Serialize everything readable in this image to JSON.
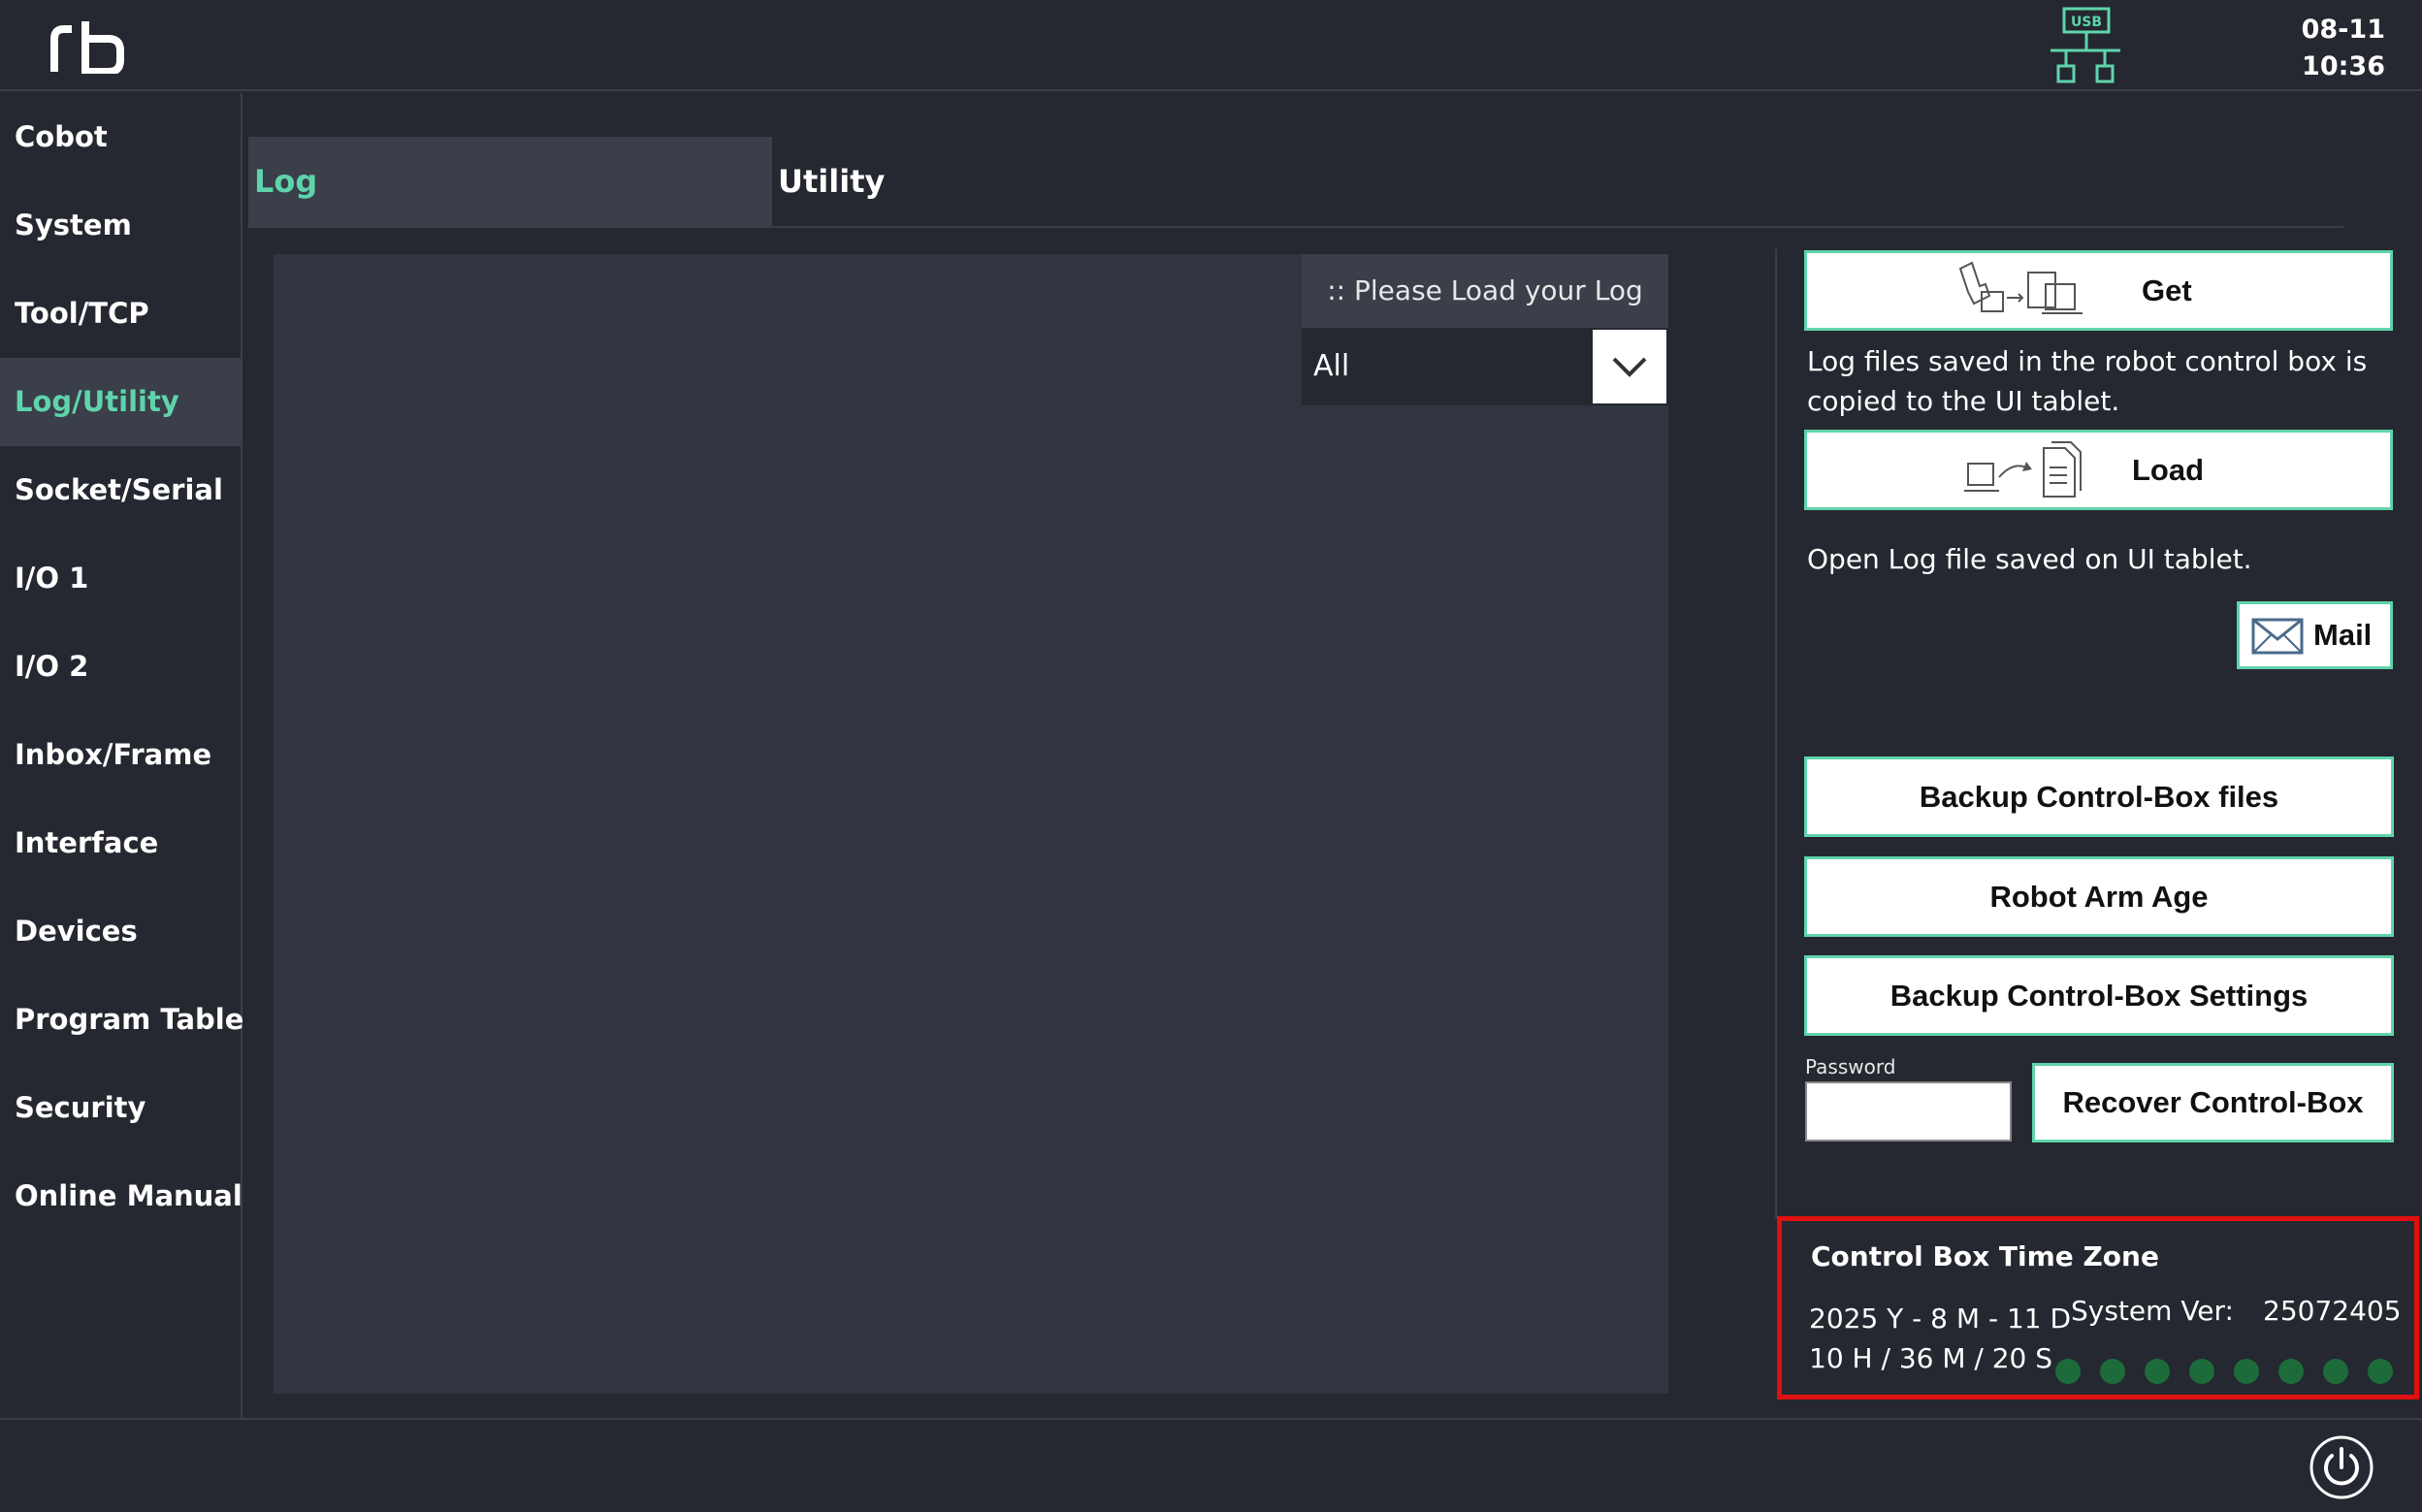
{
  "header": {
    "date": "08-11",
    "time": "10:36",
    "usb_label": "USB"
  },
  "sidebar": {
    "items": [
      {
        "label": "Cobot"
      },
      {
        "label": "System"
      },
      {
        "label": "Tool/TCP"
      },
      {
        "label": "Log/Utility",
        "active": true
      },
      {
        "label": "Socket/Serial"
      },
      {
        "label": "I/O 1"
      },
      {
        "label": "I/O 2"
      },
      {
        "label": "Inbox/Frame"
      },
      {
        "label": "Interface"
      },
      {
        "label": "Devices"
      },
      {
        "label": "Program Table"
      },
      {
        "label": "Security"
      },
      {
        "label": "Online Manual"
      }
    ]
  },
  "tabs": [
    {
      "label": "Log",
      "active": true
    },
    {
      "label": "Utility"
    }
  ],
  "log_panel": {
    "hint": ":: Please Load your Log",
    "filter_value": "All"
  },
  "utility": {
    "get_label": "Get",
    "get_desc_line1": "Log files saved in the robot control box is",
    "get_desc_line2": "copied to the UI tablet.",
    "load_label": "Load",
    "load_desc": "Open Log file saved on UI tablet.",
    "mail_label": "Mail",
    "backup_files_label": "Backup Control-Box files",
    "arm_age_label": "Robot Arm Age",
    "backup_settings_label": "Backup Control-Box Settings",
    "password_label": "Password",
    "password_value": "",
    "recover_label": "Recover Control-Box"
  },
  "timezone": {
    "title": "Control Box Time Zone",
    "date_line": "2025 Y - 8 M - 11 D",
    "time_line": "10 H / 36 M / 20 S",
    "system_ver_label": "System Ver:",
    "system_ver_value": "25072405",
    "status_dots": 8
  },
  "colors": {
    "accent": "#5fd4ab",
    "background": "#252830",
    "panel": "#31353f",
    "highlight_border": "#e01010",
    "status_dot": "#1d6b3a"
  },
  "icons": {
    "logo": "rb-logo",
    "network": "usb-network-icon",
    "get": "tablet-transfer-icon",
    "load": "document-load-icon",
    "mail": "mail-icon",
    "dropdown": "chevron-down-icon",
    "power": "power-icon"
  }
}
